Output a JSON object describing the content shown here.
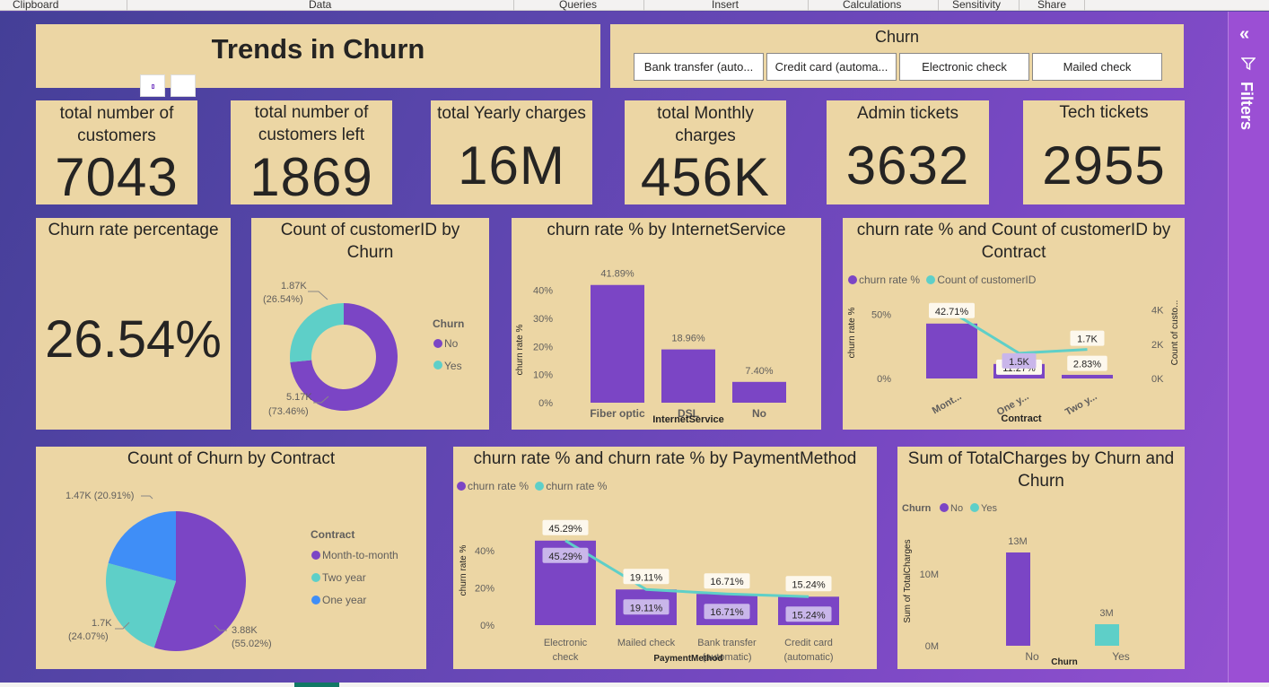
{
  "ribbon": [
    "Clipboard",
    "Data",
    "Queries",
    "Insert",
    "Calculations",
    "Sensitivity",
    "Share"
  ],
  "filters_pane": {
    "label": "Filters",
    "icon": "filter-icon",
    "collapse_icon": "double-chevron-left-icon"
  },
  "report_title": "Trends in Churn",
  "slicer": {
    "title": "Churn",
    "options": [
      "Bank transfer (auto...",
      "Credit card (automa...",
      "Electronic check",
      "Mailed check"
    ]
  },
  "kpis": [
    {
      "label": "total number of customers",
      "value": "7043"
    },
    {
      "label": "total number of customers left",
      "value": "1869"
    },
    {
      "label": "total Yearly charges",
      "value": "16M"
    },
    {
      "label": "total Monthly charges",
      "value": "456K"
    },
    {
      "label": "Admin tickets",
      "value": "3632"
    },
    {
      "label": "Tech tickets",
      "value": "2955"
    }
  ],
  "churn_rate": {
    "label": "Churn rate percentage",
    "value": "26.54%"
  },
  "colors": {
    "purple": "#7b45c5",
    "teal": "#5ecfc8",
    "blue": "#3f8ef7",
    "card": "#ecd6a4"
  },
  "chart_data": [
    {
      "type": "donut",
      "title": "Count of customerID by Churn",
      "legend_title": "Churn",
      "categories": [
        "No",
        "Yes"
      ],
      "values": [
        5170,
        1870
      ],
      "labels": [
        [
          "5.17K",
          "(73.46%)"
        ],
        [
          "1.87K",
          "(26.54%)"
        ]
      ],
      "legend": [
        "No",
        "Yes"
      ]
    },
    {
      "type": "bar",
      "title": "churn rate % by InternetService",
      "xlabel": "InternetService",
      "ylabel": "churn rate %",
      "categories": [
        "Fiber optic",
        "DSL",
        "No"
      ],
      "values": [
        41.89,
        18.96,
        7.4
      ],
      "data_labels": [
        "41.89%",
        "18.96%",
        "7.40%"
      ],
      "yticks": [
        "0%",
        "10%",
        "20%",
        "30%",
        "40%"
      ],
      "ylim": [
        0,
        45
      ]
    },
    {
      "type": "bar",
      "title": "churn rate % and Count of customerID by Contract",
      "xlabel": "Contract",
      "ylabel": "churn rate %",
      "y2label": "Count of custo...",
      "legend": [
        "churn rate %",
        "Count of customerID"
      ],
      "categories": [
        "Mont...",
        "One y...",
        "Two y..."
      ],
      "series": [
        {
          "name": "churn rate %",
          "values": [
            42.71,
            11.27,
            2.83
          ],
          "labels": [
            "42.71%",
            "11.27%",
            "2.83%"
          ]
        },
        {
          "name": "Count of customerID",
          "values": [
            3875,
            1473,
            1695
          ],
          "labels": [
            "",
            "1.5K",
            "1.7K"
          ]
        }
      ],
      "yticks": [
        "0%",
        "50%"
      ],
      "y2ticks": [
        "0K",
        "2K",
        "4K"
      ],
      "ylim": [
        0,
        60
      ],
      "y2lim": [
        0,
        4500
      ]
    },
    {
      "type": "pie",
      "title": "Count of Churn by Contract",
      "legend_title": "Contract",
      "categories": [
        "Month-to-month",
        "Two year",
        "One year"
      ],
      "values": [
        3880,
        1700,
        1470
      ],
      "labels": [
        [
          "3.88K",
          "(55.02%)"
        ],
        [
          "1.7K",
          "(24.07%)"
        ],
        [
          "1.47K (20.91%)"
        ]
      ],
      "legend": [
        "Month-to-month",
        "Two year",
        "One year"
      ]
    },
    {
      "type": "bar",
      "title": "churn rate % and churn rate % by PaymentMethod",
      "xlabel": "PaymentMethod",
      "ylabel": "churn rate %",
      "legend": [
        "churn rate %",
        "churn rate %"
      ],
      "categories": [
        [
          "Electronic",
          "check"
        ],
        [
          "Mailed check"
        ],
        [
          "Bank transfer",
          "(automatic)"
        ],
        [
          "Credit card",
          "(automatic)"
        ]
      ],
      "series": [
        {
          "name": "churn rate %",
          "values": [
            45.29,
            19.11,
            16.71,
            15.24
          ],
          "labels": [
            "45.29%",
            "19.11%",
            "16.71%",
            "15.24%"
          ]
        },
        {
          "name": "churn rate %",
          "values": [
            45.29,
            19.11,
            16.71,
            15.24
          ],
          "labels": [
            "45.29%",
            "19.11%",
            "16.71%",
            "15.24%"
          ]
        }
      ],
      "yticks": [
        "0%",
        "20%",
        "40%"
      ],
      "ylim": [
        0,
        50
      ]
    },
    {
      "type": "bar",
      "title": "Sum of TotalCharges by Churn and Churn",
      "xlabel": "Churn",
      "ylabel": "Sum of TotalCharges",
      "legend_title": "Churn",
      "legend": [
        "No",
        "Yes"
      ],
      "categories": [
        "No",
        "Yes"
      ],
      "values": [
        13000000,
        3000000
      ],
      "data_labels": [
        "13M",
        "3M"
      ],
      "yticks": [
        "0M",
        "10M"
      ],
      "ylim": [
        0,
        15000000
      ]
    }
  ]
}
